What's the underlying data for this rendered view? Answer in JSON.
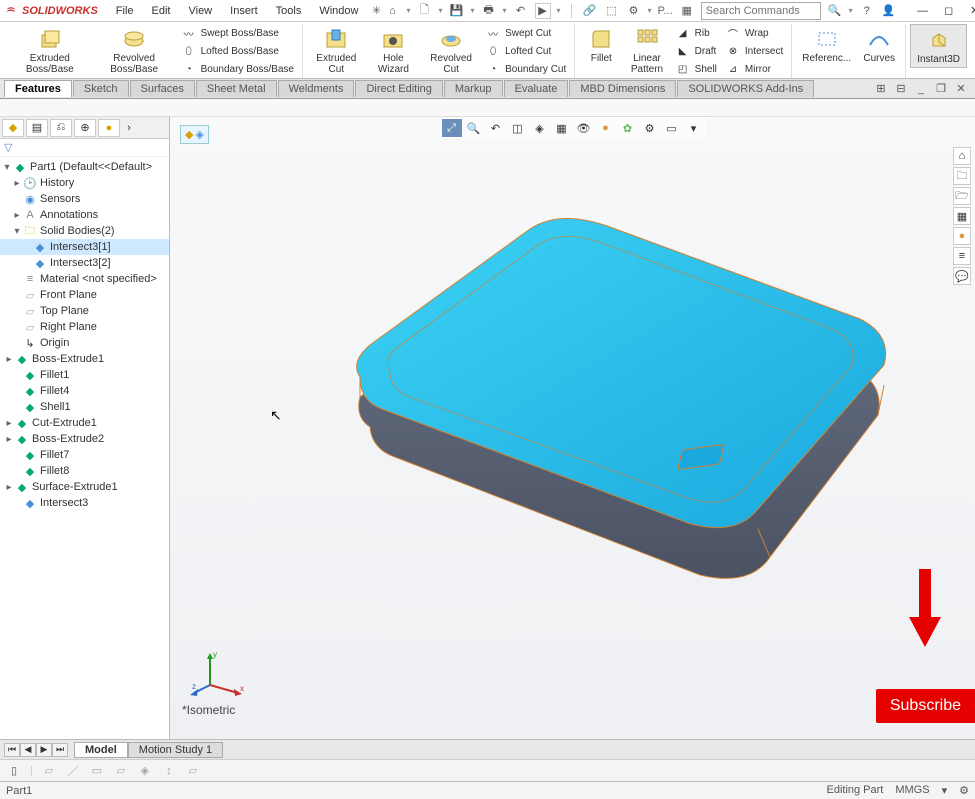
{
  "app": {
    "name": "SOLIDWORKS"
  },
  "menu": [
    "File",
    "Edit",
    "View",
    "Insert",
    "Tools",
    "Window"
  ],
  "title_tools": {
    "p_label": "P...",
    "search_placeholder": "Search Commands"
  },
  "ribbon": {
    "extruded_boss": "Extruded Boss/Base",
    "revolved_boss": "Revolved Boss/Base",
    "swept_boss": "Swept Boss/Base",
    "lofted_boss": "Lofted Boss/Base",
    "boundary_boss": "Boundary Boss/Base",
    "extruded_cut": "Extruded Cut",
    "hole_wizard": "Hole Wizard",
    "revolved_cut": "Revolved Cut",
    "swept_cut": "Swept Cut",
    "lofted_cut": "Lofted Cut",
    "boundary_cut": "Boundary Cut",
    "fillet": "Fillet",
    "linear_pattern": "Linear Pattern",
    "rib": "Rib",
    "draft": "Draft",
    "shell": "Shell",
    "wrap": "Wrap",
    "intersect": "Intersect",
    "mirror": "Mirror",
    "reference": "Referenc...",
    "curves": "Curves",
    "instant3d": "Instant3D"
  },
  "tabs": [
    "Features",
    "Sketch",
    "Surfaces",
    "Sheet Metal",
    "Weldments",
    "Direct Editing",
    "Markup",
    "Evaluate",
    "MBD Dimensions",
    "SOLIDWORKS Add-Ins"
  ],
  "tree": {
    "root": "Part1  (Default<<Default>",
    "items": [
      "History",
      "Sensors",
      "Annotations",
      "Solid Bodies(2)",
      "Intersect3[1]",
      "Intersect3[2]",
      "Material <not specified>",
      "Front Plane",
      "Top Plane",
      "Right Plane",
      "Origin",
      "Boss-Extrude1",
      "Fillet1",
      "Fillet4",
      "Shell1",
      "Cut-Extrude1",
      "Boss-Extrude2",
      "Fillet7",
      "Fillet8",
      "Surface-Extrude1",
      "Intersect3"
    ]
  },
  "view": {
    "label": "*Isometric"
  },
  "bottom_tabs": [
    "Model",
    "Motion Study 1"
  ],
  "status": {
    "left": "Part1",
    "editing": "Editing Part",
    "units": "MMGS"
  },
  "overlay": {
    "subscribe": "Subscribe"
  }
}
